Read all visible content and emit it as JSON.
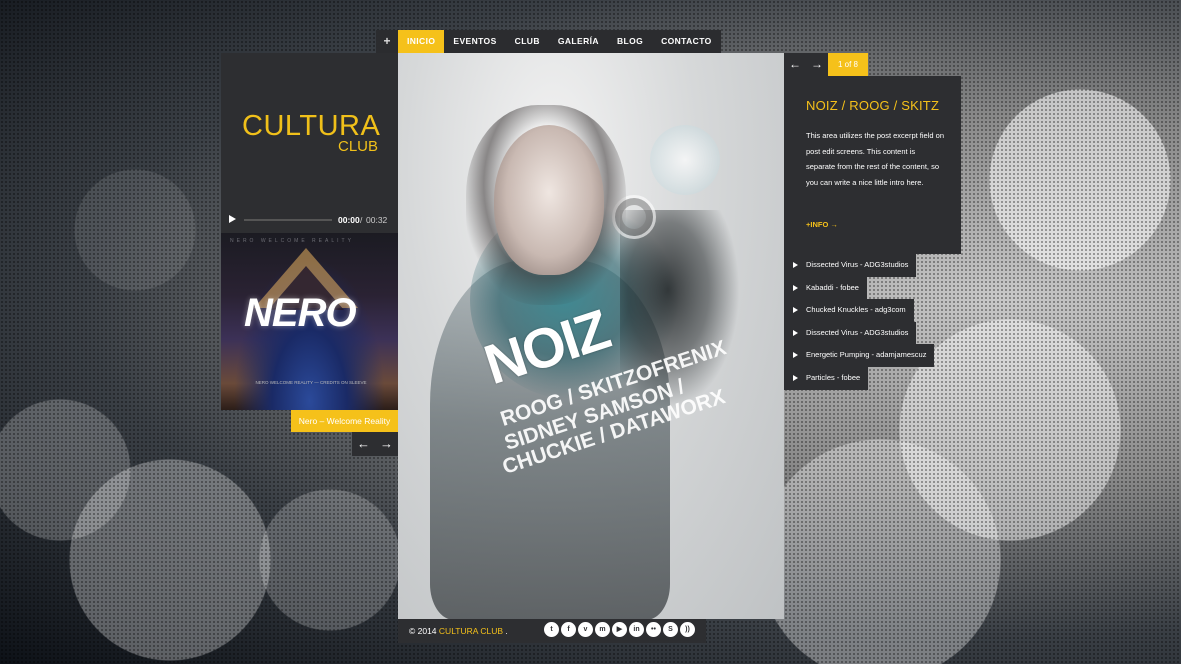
{
  "nav": {
    "plus": "+",
    "items": [
      "INICIO",
      "EVENTOS",
      "CLUB",
      "GALERÍA",
      "BLOG",
      "CONTACTO"
    ]
  },
  "logo": {
    "main": "CULTURA",
    "sub": "CLUB"
  },
  "player": {
    "current": "00:00",
    "separator": "/",
    "total": "00:32"
  },
  "album": {
    "top_text": "NERO  WELCOME  REALITY",
    "logo": "NERO",
    "credits": "NERO WELCOME REALITY — CREDITS ON SLEEVE",
    "caption": "Nero – Welcome Reality",
    "prev": "←",
    "next": "→"
  },
  "poster": {
    "title": "NOIZ",
    "lines": [
      "ROOG / SKITZOFRENIX",
      "SIDNEY SAMSON /",
      "CHUCKIE / DATAWORX"
    ]
  },
  "footer": {
    "prefix": "© 2014",
    "brand": "CULTURA CLUB",
    "suffix": ".",
    "socials": [
      {
        "icon": "twitter-icon",
        "glyph": "t"
      },
      {
        "icon": "facebook-icon",
        "glyph": "f"
      },
      {
        "icon": "vimeo-icon",
        "glyph": "v"
      },
      {
        "icon": "myspace-icon",
        "glyph": "m"
      },
      {
        "icon": "youtube-icon",
        "glyph": "▶"
      },
      {
        "icon": "linkedin-icon",
        "glyph": "in"
      },
      {
        "icon": "flickr-icon",
        "glyph": "••"
      },
      {
        "icon": "skype-icon",
        "glyph": "S"
      },
      {
        "icon": "rss-icon",
        "glyph": "))"
      }
    ]
  },
  "pager": {
    "prev": "←",
    "next": "→",
    "counter": "1 of 8"
  },
  "info": {
    "title": "NOIZ / ROOG / SKITZ",
    "text": "This area utilizes the post excerpt field on post edit screens. This content is separate from the rest of the content, so you can write a nice little intro here.",
    "link": "+INFO →"
  },
  "tracks": [
    "Dissected Virus - ADG3studios",
    "Kabaddi - fobee",
    "Chucked Knuckles - adg3com",
    "Dissected Virus - ADG3studios",
    "Energetic Pumping - adamjamescuz",
    "Particles - fobee"
  ],
  "colors": {
    "accent": "#f5c11a",
    "panel": "#2d2e31"
  }
}
